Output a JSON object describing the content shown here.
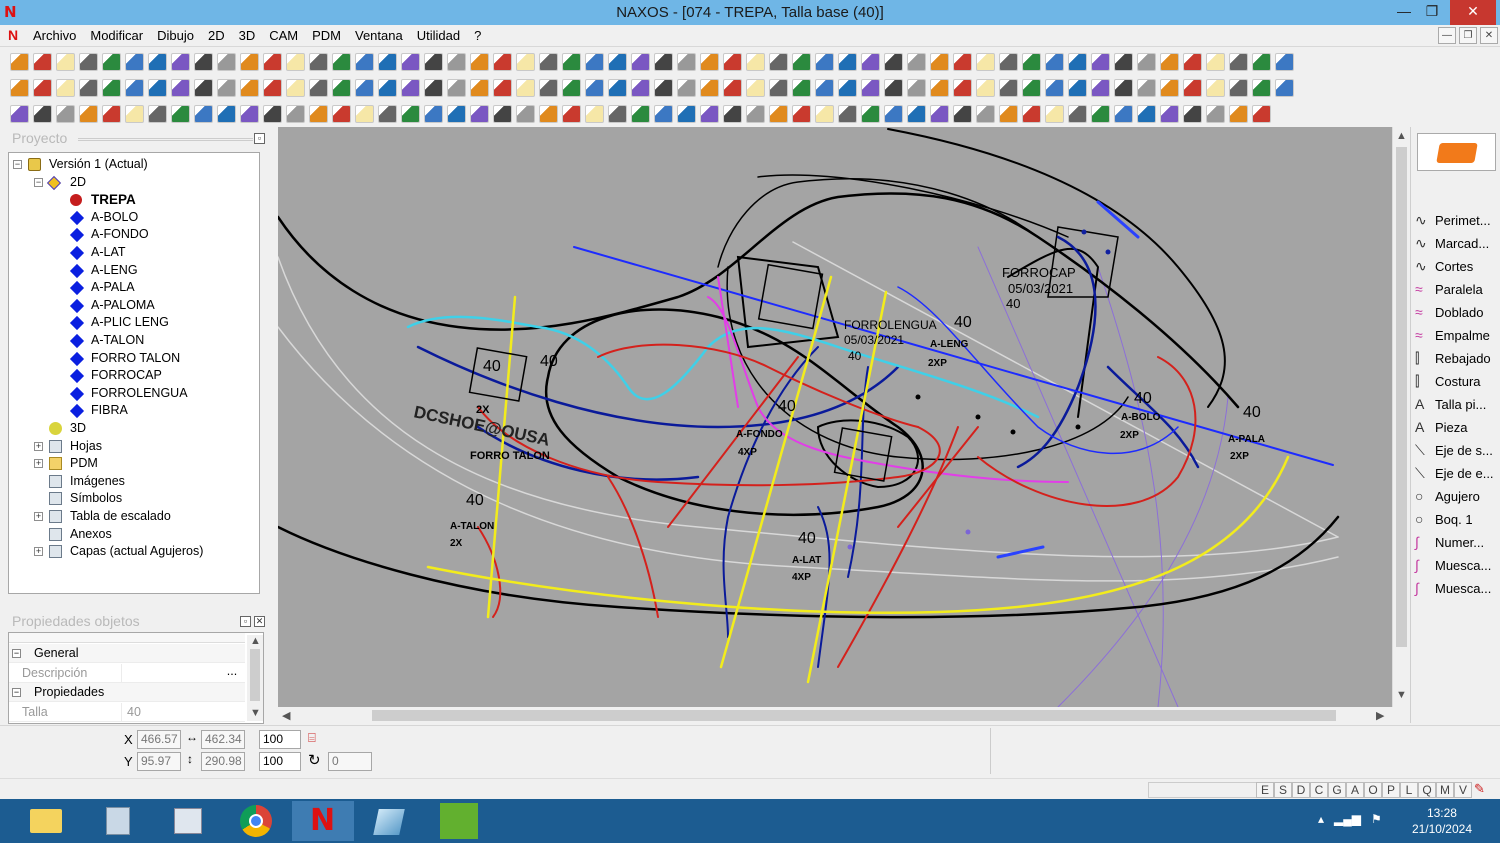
{
  "window": {
    "title": "NAXOS - [074 - TREPA, Talla base (40)]",
    "minimize": "—",
    "restore": "❐",
    "close": "✕"
  },
  "menu": [
    "Archivo",
    "Modificar",
    "Dibujo",
    "2D",
    "3D",
    "CAM",
    "PDM",
    "Ventana",
    "Utilidad",
    "?"
  ],
  "project_panel": {
    "title": "Proyecto",
    "tree": [
      {
        "label": "Versión 1 (Actual)",
        "level": 0,
        "expander": "−",
        "icon": "version-icon"
      },
      {
        "label": "2D",
        "level": 1,
        "expander": "−",
        "icon": "2d-icon"
      },
      {
        "label": "TREPA",
        "level": 2,
        "icon": "red-dot-icon",
        "bold": true
      },
      {
        "label": "A-BOLO",
        "level": 2,
        "icon": "diamond-icon"
      },
      {
        "label": "A-FONDO",
        "level": 2,
        "icon": "diamond-icon"
      },
      {
        "label": "A-LAT",
        "level": 2,
        "icon": "diamond-icon"
      },
      {
        "label": "A-LENG",
        "level": 2,
        "icon": "diamond-icon"
      },
      {
        "label": "A-PALA",
        "level": 2,
        "icon": "diamond-icon"
      },
      {
        "label": "A-PALOMA",
        "level": 2,
        "icon": "diamond-icon"
      },
      {
        "label": "A-PLIC LENG",
        "level": 2,
        "icon": "diamond-icon"
      },
      {
        "label": "A-TALON",
        "level": 2,
        "icon": "diamond-icon"
      },
      {
        "label": "FORRO TALON",
        "level": 2,
        "icon": "diamond-icon"
      },
      {
        "label": "FORROCAP",
        "level": 2,
        "icon": "diamond-icon"
      },
      {
        "label": "FORROLENGUA",
        "level": 2,
        "icon": "diamond-icon"
      },
      {
        "label": "FIBRA",
        "level": 2,
        "icon": "diamond-icon"
      },
      {
        "label": "3D",
        "level": 1,
        "icon": "3d-icon"
      },
      {
        "label": "Hojas",
        "level": 1,
        "expander": "+",
        "icon": "sheets-icon"
      },
      {
        "label": "PDM",
        "level": 1,
        "expander": "+",
        "icon": "folder-icon"
      },
      {
        "label": "Imágenes",
        "level": 1,
        "icon": "images-icon"
      },
      {
        "label": "Símbolos",
        "level": 1,
        "icon": "symbols-icon"
      },
      {
        "label": "Tabla de escalado",
        "level": 1,
        "expander": "+",
        "icon": "table-icon"
      },
      {
        "label": "Anexos",
        "level": 1,
        "icon": "attachment-icon"
      },
      {
        "label": "Capas (actual Agujeros)",
        "level": 1,
        "expander": "+",
        "icon": "layers-icon"
      }
    ]
  },
  "properties_panel": {
    "title": "Propiedades objetos",
    "rows": [
      {
        "type": "section",
        "label": "General"
      },
      {
        "type": "field",
        "label": "Descripción",
        "value": "",
        "button": "..."
      },
      {
        "type": "section",
        "label": "Propiedades"
      },
      {
        "type": "field",
        "label": "Talla",
        "value": "40"
      }
    ]
  },
  "drawing_labels": [
    {
      "text": "40"
    },
    {
      "text": "FORRO TALON"
    },
    {
      "text": "DCSHOE@OUSA"
    },
    {
      "text": "2X"
    },
    {
      "text": "40"
    },
    {
      "text": "A-TALON"
    },
    {
      "text": "2X"
    },
    {
      "text": "40"
    },
    {
      "text": "FORROLENGUA"
    },
    {
      "text": "05/03/2021"
    },
    {
      "text": "40"
    },
    {
      "text": "40"
    },
    {
      "text": "A-LENG"
    },
    {
      "text": "2XP"
    },
    {
      "text": "FORROCAP"
    },
    {
      "text": "05/03/2021"
    },
    {
      "text": "40"
    },
    {
      "text": "40"
    },
    {
      "text": "A-FONDO"
    },
    {
      "text": "4XP"
    },
    {
      "text": "40"
    },
    {
      "text": "A-LAT"
    },
    {
      "text": "4XP"
    },
    {
      "text": "40"
    },
    {
      "text": "A-BOLO"
    },
    {
      "text": "2XP"
    },
    {
      "text": "40"
    },
    {
      "text": "A-PALA"
    },
    {
      "text": "2XP"
    }
  ],
  "right_panel": {
    "items": [
      {
        "label": "Perimet...",
        "icon": "curve-icon"
      },
      {
        "label": "Marcad...",
        "icon": "curve-icon"
      },
      {
        "label": "Cortes",
        "icon": "curve-icon"
      },
      {
        "label": "Paralela",
        "icon": "parallel-icon"
      },
      {
        "label": "Doblado",
        "icon": "fold-icon"
      },
      {
        "label": "Empalme",
        "icon": "join-icon"
      },
      {
        "label": "Rebajado",
        "icon": "skive-icon"
      },
      {
        "label": "Costura",
        "icon": "seam-icon"
      },
      {
        "label": "Talla pi...",
        "icon": "text-icon"
      },
      {
        "label": "Pieza",
        "icon": "text-icon"
      },
      {
        "label": "Eje de s...",
        "icon": "axis-icon"
      },
      {
        "label": "Eje de e...",
        "icon": "axis-icon"
      },
      {
        "label": "Agujero",
        "icon": "circle-icon"
      },
      {
        "label": "Boq. 1",
        "icon": "circle-icon"
      },
      {
        "label": "Numer...",
        "icon": "number-icon"
      },
      {
        "label": "Muesca...",
        "icon": "notch-icon"
      },
      {
        "label": "Muesca...",
        "icon": "notch-icon"
      }
    ]
  },
  "coords": {
    "x_label": "X",
    "y_label": "Y",
    "x": "466.57",
    "y": "95.97",
    "w": "462.34",
    "h": "290.98",
    "scale_x": "100",
    "scale_y": "100",
    "rotation": "0"
  },
  "status_letters": [
    "E",
    "S",
    "D",
    "C",
    "G",
    "A",
    "O",
    "P",
    "L",
    "Q",
    "M",
    "V"
  ],
  "taskbar": {
    "time": "13:28",
    "date": "21/10/2024"
  }
}
